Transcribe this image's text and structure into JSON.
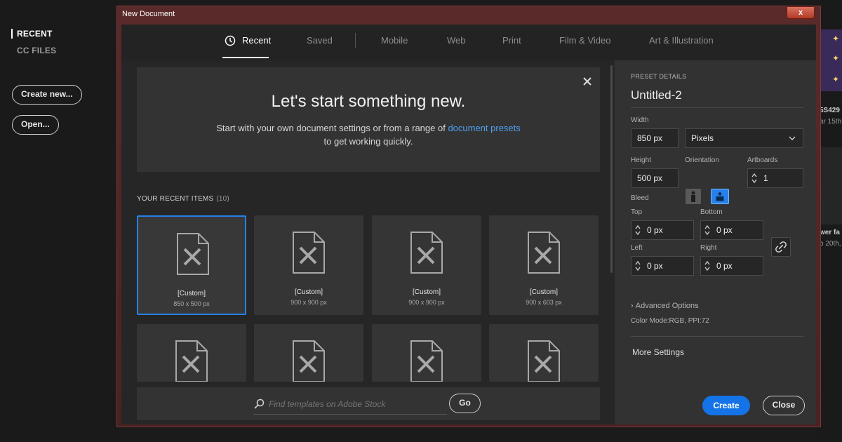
{
  "home": {
    "nav": [
      "RECENT",
      "CC FILES"
    ],
    "create_new_label": "Create new...",
    "open_label": "Open..."
  },
  "background_right": {
    "texts": [
      "5S429",
      "ar 15th,",
      "wer fa",
      "b 20th,"
    ]
  },
  "dialog": {
    "title": "New Document",
    "close_symbol": "x",
    "tabs": [
      {
        "label": "Recent",
        "active": true
      },
      {
        "label": "Saved",
        "active": false
      },
      {
        "label": "Mobile",
        "active": false
      },
      {
        "label": "Web",
        "active": false
      },
      {
        "label": "Print",
        "active": false
      },
      {
        "label": "Film & Video",
        "active": false
      },
      {
        "label": "Art & Illustration",
        "active": false
      }
    ],
    "banner": {
      "title": "Let's start something new.",
      "subtitle_prefix": "Start with your own document settings or from a range of ",
      "subtitle_link": "document presets",
      "subtitle_suffix": "to get working quickly."
    },
    "recent": {
      "label": "YOUR RECENT ITEMS",
      "count": "(10)",
      "items": [
        {
          "name": "[Custom]",
          "dims": "850 x 500 px",
          "selected": true
        },
        {
          "name": "[Custom]",
          "dims": "900 x 900 px",
          "selected": false
        },
        {
          "name": "[Custom]",
          "dims": "900 x 900 px",
          "selected": false
        },
        {
          "name": "[Custom]",
          "dims": "900 x 603 px",
          "selected": false
        }
      ]
    },
    "search": {
      "placeholder": "Find templates on Adobe Stock",
      "go_label": "Go"
    },
    "preset": {
      "heading": "PRESET DETAILS",
      "doc_name": "Untitled-2",
      "width_label": "Width",
      "width_value": "850 px",
      "unit_value": "Pixels",
      "height_label": "Height",
      "height_value": "500 px",
      "orientation_label": "Orientation",
      "artboards_label": "Artboards",
      "artboards_value": "1",
      "bleed_label": "Bleed",
      "top_label": "Top",
      "top_value": "0 px",
      "bottom_label": "Bottom",
      "bottom_value": "0 px",
      "left_label": "Left",
      "left_value": "0 px",
      "right_label": "Right",
      "right_value": "0 px",
      "advanced_label": "Advanced Options",
      "color_mode": "Color Mode:RGB, PPI:72",
      "more_settings": "More Settings",
      "create_label": "Create",
      "close_label": "Close"
    },
    "colors": {
      "accent": "#2680eb",
      "create_button": "#1473e6",
      "link": "#4ea0f0"
    }
  }
}
